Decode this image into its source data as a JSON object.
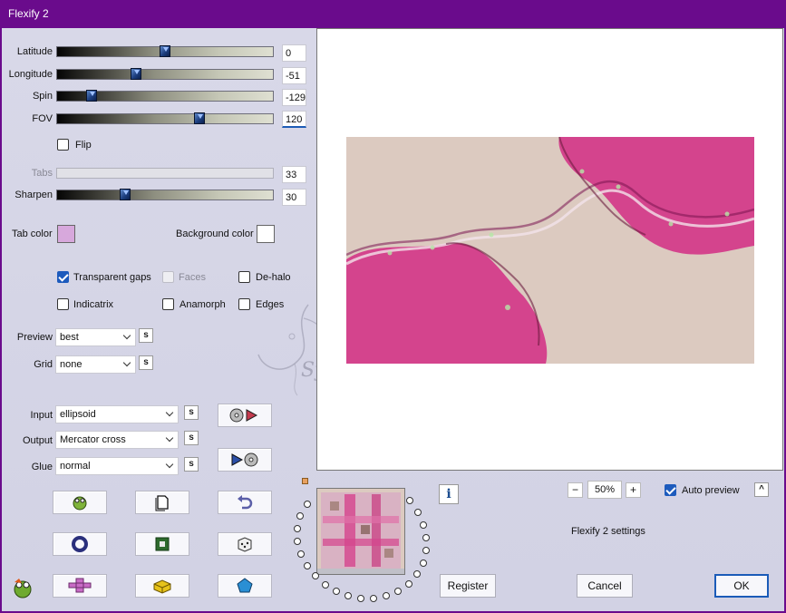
{
  "window": {
    "title": "Flexify 2"
  },
  "sliders": [
    {
      "label": "Latitude",
      "value": "0",
      "fraction": 0.5
    },
    {
      "label": "Longitude",
      "value": "-51",
      "fraction": 0.36
    },
    {
      "label": "Spin",
      "value": "-129",
      "fraction": 0.14
    },
    {
      "label": "FOV",
      "value": "120",
      "fraction": 0.67
    },
    {
      "label": "Tabs",
      "value": "33",
      "disabled": true
    },
    {
      "label": "Sharpen",
      "value": "30",
      "fraction": 0.31
    }
  ],
  "flip": {
    "label": "Flip",
    "checked": false
  },
  "colors": {
    "tab_color_label": "Tab color",
    "tab_color": "#d7a8dc",
    "background_color_label": "Background color",
    "background_color": "#ffffff"
  },
  "options": {
    "transparent_gaps": {
      "label": "Transparent gaps",
      "checked": true
    },
    "faces": {
      "label": "Faces",
      "checked": false,
      "disabled": true
    },
    "de_halo": {
      "label": "De-halo",
      "checked": false
    },
    "indicatrix": {
      "label": "Indicatrix",
      "checked": false
    },
    "anamorph": {
      "label": "Anamorph",
      "checked": false
    },
    "edges": {
      "label": "Edges",
      "checked": false
    }
  },
  "dropdowns": {
    "preview": {
      "label": "Preview",
      "value": "best"
    },
    "grid": {
      "label": "Grid",
      "value": "none"
    },
    "input": {
      "label": "Input",
      "value": "ellipsoid"
    },
    "output": {
      "label": "Output",
      "value": "Mercator cross"
    },
    "glue": {
      "label": "Glue",
      "value": "normal"
    }
  },
  "small_button_label": "s",
  "zoom": {
    "value": "50%",
    "minus": "−",
    "plus": "+"
  },
  "auto_preview": {
    "label": "Auto preview",
    "checked": true
  },
  "collapse_label": "^",
  "settings_label": "Flexify 2 settings",
  "info_label": "i",
  "buttons": {
    "register": "Register",
    "cancel": "Cancel",
    "ok": "OK"
  },
  "watermark": "Sylviane",
  "accent": "#1d5bbd",
  "titlebar_color": "#6a0b8c",
  "preview_colors": {
    "pink": "#d4448d",
    "beige": "#dccac0"
  }
}
